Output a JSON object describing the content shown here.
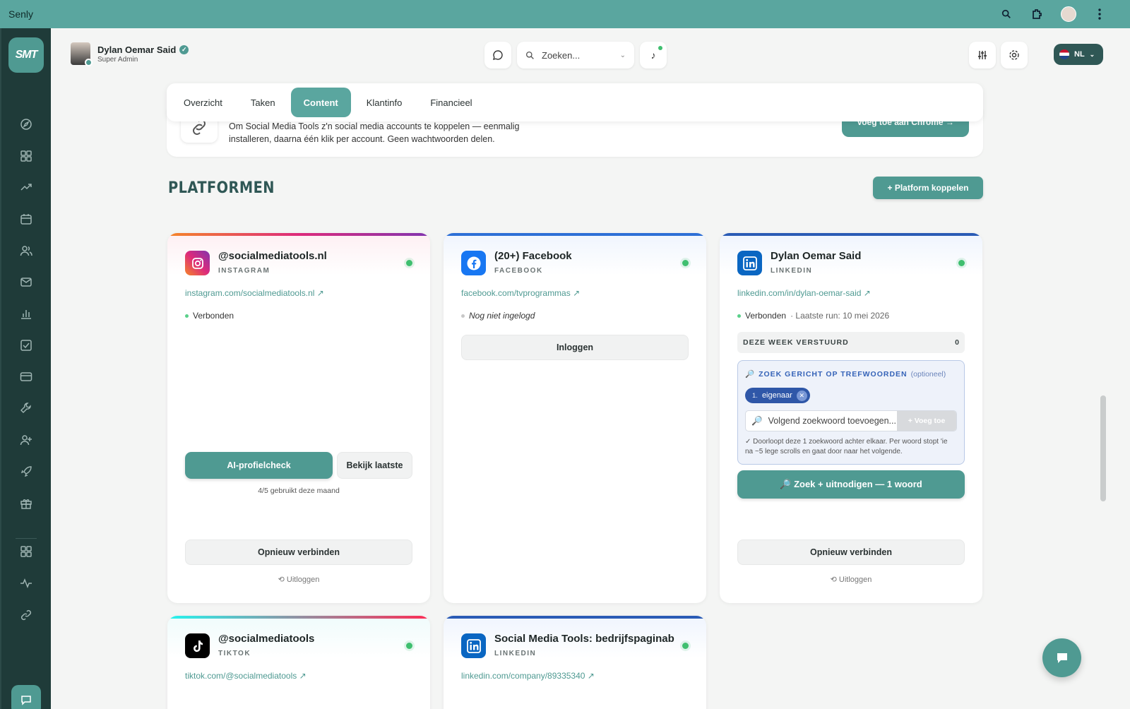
{
  "app": {
    "title": "Senly"
  },
  "header": {
    "user_name": "Dylan Oemar Said",
    "user_role": "Super Admin",
    "search_placeholder": "Zoeken...",
    "language": "NL"
  },
  "logo_text": "SMT",
  "tabs": [
    {
      "label": "Overzicht",
      "active": false
    },
    {
      "label": "Taken",
      "active": false
    },
    {
      "label": "Content",
      "active": true
    },
    {
      "label": "Klantinfo",
      "active": false
    },
    {
      "label": "Financieel",
      "active": false
    }
  ],
  "banner": {
    "text": "Om Social Media Tools z'n social media accounts te koppelen — eenmalig installeren, daarna één klik per account. Geen wachtwoorden delen.",
    "button": "Voeg toe aan Chrome →"
  },
  "platforms": {
    "title": "PLATFORMEN",
    "add_button": "+ Platform koppelen",
    "cards": [
      {
        "name": "@socialmediatools.nl",
        "type": "INSTAGRAM",
        "link": "instagram.com/socialmediatools.nl ↗",
        "status": "Verbonden",
        "ai_button": "AI-profielcheck",
        "latest_button": "Bekijk laatste",
        "usage": "4/5 gebruikt deze maand",
        "reconnect": "Opnieuw verbinden",
        "logout": "Uitloggen"
      },
      {
        "name": "(20+) Facebook",
        "type": "FACEBOOK",
        "link": "facebook.com/tvprogrammas ↗",
        "status": "Nog niet ingelogd",
        "login_button": "Inloggen"
      },
      {
        "name": "Dylan Oemar Said",
        "type": "LINKEDIN",
        "link": "linkedin.com/in/dylan-oemar-said ↗",
        "status": "Verbonden",
        "last_run": "· Laatste run: 10 mei 2026",
        "week_label": "DEZE WEEK VERSTUURD",
        "week_count": "0",
        "keywords_title": "ZOEK GERICHT OP TREFWOORDEN",
        "keywords_optional": "(optioneel)",
        "chip_num": "1.",
        "chip_label": "eigenaar",
        "kw_placeholder": "Volgend zoekwoord toevoegen...",
        "kw_add": "+ Voeg toe",
        "kw_help": "✓ Doorloopt deze 1 zoekwoord achter elkaar. Per woord stopt 'ie na ~5 lege scrolls en gaat door naar het volgende.",
        "search_button": "🔎 Zoek + uitnodigen — 1 woord",
        "reconnect": "Opnieuw verbinden",
        "logout": "Uitloggen"
      },
      {
        "name": "@socialmediatools",
        "type": "TIKTOK",
        "link": "tiktok.com/@socialmediatools ↗"
      },
      {
        "name": "Social Media Tools: bedrijfspaginabeheer",
        "type": "LINKEDIN",
        "link": "linkedin.com/company/89335340 ↗"
      }
    ]
  },
  "colors": {
    "accent": "#4f9a92",
    "topbar": "#5aa69f",
    "sidebar": "#1f3b39",
    "instagram": "#dd2a7b",
    "facebook": "#1877f2",
    "linkedin": "#0a66c2",
    "tiktok": "#000000"
  }
}
